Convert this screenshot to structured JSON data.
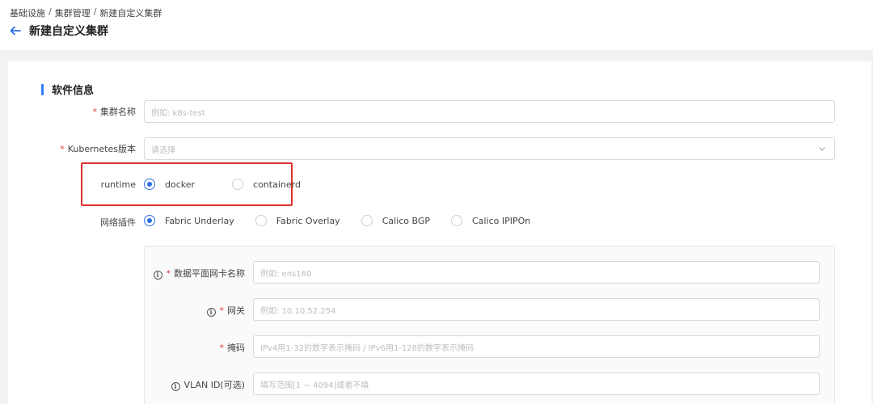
{
  "breadcrumb": [
    "基础设施",
    "集群管理",
    "新建自定义集群"
  ],
  "breadcrumb_sep": "/",
  "page_title": "新建自定义集群",
  "section": {
    "title": "软件信息"
  },
  "form": {
    "cluster_name": {
      "label": "集群名称",
      "placeholder": "例如: k8s-test"
    },
    "k8s_version": {
      "label": "Kubernetes版本",
      "placeholder": "请选择"
    },
    "runtime": {
      "label": "runtime",
      "options": [
        "docker",
        "containerd"
      ],
      "selected": "docker"
    },
    "network_plugin": {
      "label": "网络插件",
      "options": [
        "Fabric Underlay",
        "Fabric Overlay",
        "Calico BGP",
        "Calico IPIPOn"
      ],
      "selected": "Fabric Underlay"
    },
    "nic_name": {
      "label": "数据平面网卡名称",
      "placeholder": "例如: ens160"
    },
    "gateway": {
      "label": "网关",
      "placeholder": "例如: 10.10.52.254"
    },
    "mask": {
      "label": "掩码",
      "placeholder": "IPv4用1-32的数字表示掩码 / IPv6用1-128的数字表示掩码"
    },
    "vlan_id": {
      "label": "VLAN ID(可选)",
      "placeholder": "填写范围[1 ~ 4094]或者不填"
    }
  },
  "required_mark": "*",
  "info_mark": "i",
  "colors": {
    "accent": "#2f6fe4",
    "required": "#e03a3a",
    "highlight_box": "#e0302b"
  }
}
